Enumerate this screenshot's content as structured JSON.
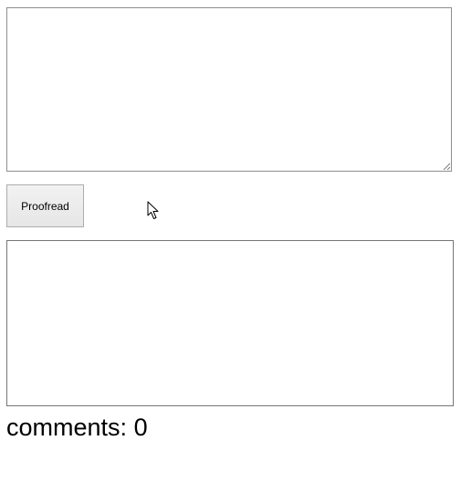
{
  "input": {
    "value": "",
    "placeholder": ""
  },
  "proofread_button": {
    "label": "Proofread"
  },
  "output": {
    "text": ""
  },
  "comments": {
    "label": "comments:",
    "count": "0"
  }
}
